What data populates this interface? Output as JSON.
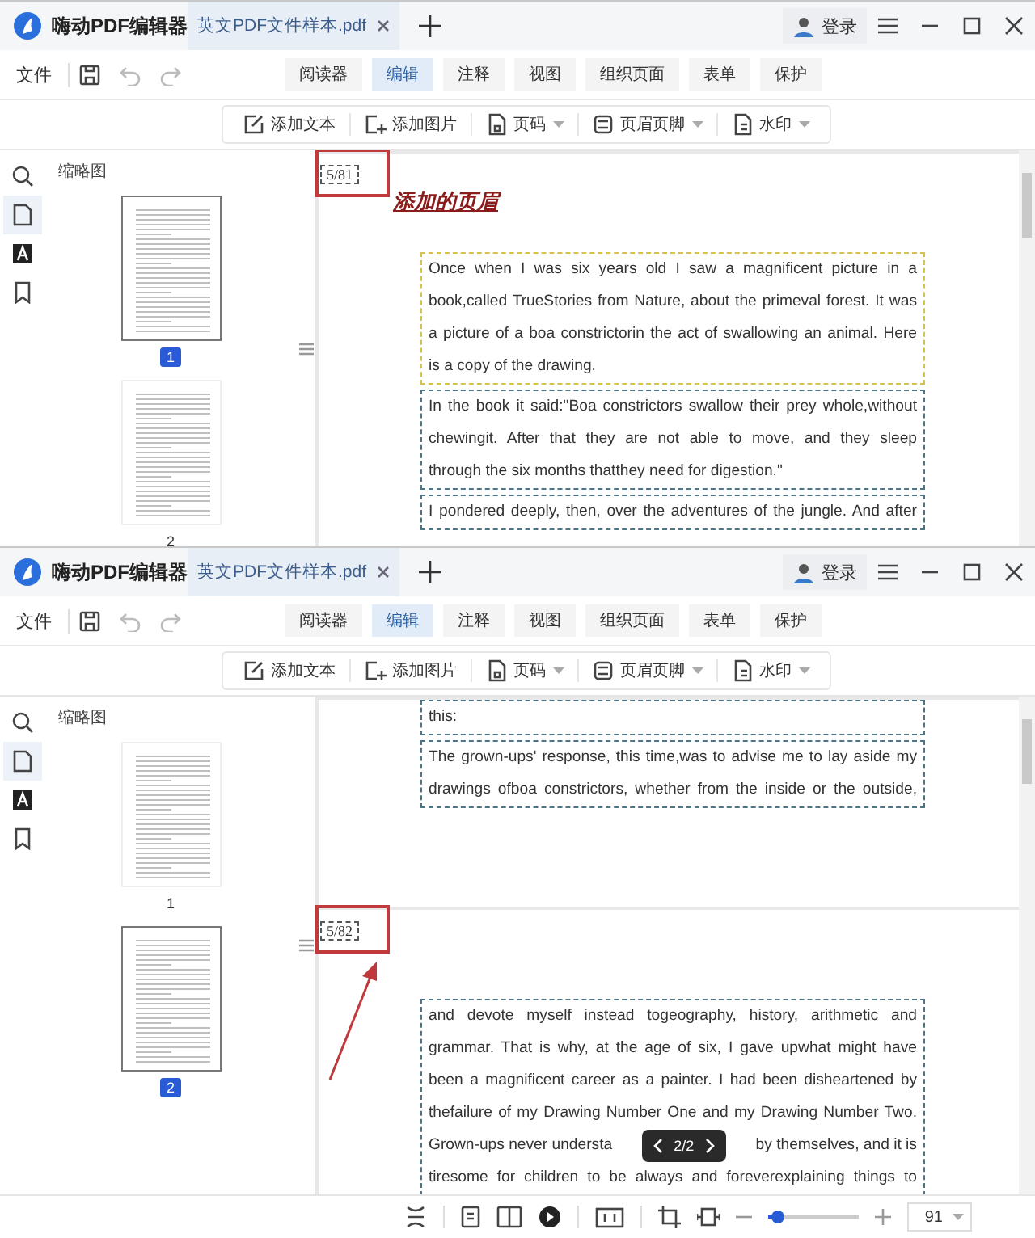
{
  "windows": [
    {
      "app_title": "嗨动PDF编辑器",
      "tab_title": "英文PDF文件样本.pdf",
      "login": "登录",
      "file_menu": "文件",
      "ribbon_tabs": [
        {
          "label": "阅读器",
          "selected": false
        },
        {
          "label": "编辑",
          "selected": true
        },
        {
          "label": "注释",
          "selected": false
        },
        {
          "label": "视图",
          "selected": false
        },
        {
          "label": "组织页面",
          "selected": false
        },
        {
          "label": "表单",
          "selected": false
        },
        {
          "label": "保护",
          "selected": false
        }
      ],
      "tools": [
        {
          "kind": "text",
          "label": "添加文本",
          "dropdown": false
        },
        {
          "kind": "image",
          "label": "添加图片",
          "dropdown": false
        },
        {
          "kind": "pagenum",
          "label": "页码",
          "dropdown": true
        },
        {
          "kind": "headerfooter",
          "label": "页眉页脚",
          "dropdown": true
        },
        {
          "kind": "watermark",
          "label": "水印",
          "dropdown": true
        }
      ],
      "sidebar": {
        "title": "缩略图",
        "rail": [
          {
            "kind": "search",
            "selected": false
          },
          {
            "kind": "page",
            "selected": true
          },
          {
            "kind": "font",
            "selected": false
          },
          {
            "kind": "bookmark",
            "selected": false
          }
        ],
        "thumbnails": [
          {
            "label": "1",
            "selected": true
          },
          {
            "label": "2",
            "selected": false
          }
        ]
      },
      "pages": [
        {
          "stamp": {
            "text": "5/81",
            "highlighted": true,
            "arrow": false
          },
          "header": "添加的页眉",
          "blocks": [
            {
              "color": "#d6c24c",
              "continues": false,
              "lines": [
                "Once when I was six years old I saw a magnificent picture in a",
                "book,called TrueStories from Nature, about the primeval forest. It was",
                "a picture of a boa constrictorin the act of swallowing an animal. Here",
                "is a copy of the drawing."
              ]
            },
            {
              "color": "#4d7585",
              "continues": false,
              "lines": [
                "In the book it said:\"Boa constrictors swallow their prey whole,without",
                "chewingit. After that they are not able to move, and they sleep",
                "through the six months thatthey need for digestion.\""
              ]
            },
            {
              "color": "#4d7585",
              "continues": true,
              "lines": [
                "I pondered deeply, then, over the adventures of the jungle. And after"
              ]
            }
          ]
        }
      ]
    },
    {
      "app_title": "嗨动PDF编辑器",
      "tab_title": "英文PDF文件样本.pdf",
      "login": "登录",
      "file_menu": "文件",
      "ribbon_tabs": [
        {
          "label": "阅读器",
          "selected": false
        },
        {
          "label": "编辑",
          "selected": true
        },
        {
          "label": "注释",
          "selected": false
        },
        {
          "label": "视图",
          "selected": false
        },
        {
          "label": "组织页面",
          "selected": false
        },
        {
          "label": "表单",
          "selected": false
        },
        {
          "label": "保护",
          "selected": false
        }
      ],
      "tools": [
        {
          "kind": "text",
          "label": "添加文本",
          "dropdown": false
        },
        {
          "kind": "image",
          "label": "添加图片",
          "dropdown": false
        },
        {
          "kind": "pagenum",
          "label": "页码",
          "dropdown": true
        },
        {
          "kind": "headerfooter",
          "label": "页眉页脚",
          "dropdown": true
        },
        {
          "kind": "watermark",
          "label": "水印",
          "dropdown": true
        }
      ],
      "sidebar": {
        "title": "缩略图",
        "rail": [
          {
            "kind": "search",
            "selected": false
          },
          {
            "kind": "page",
            "selected": true
          },
          {
            "kind": "font",
            "selected": false
          },
          {
            "kind": "bookmark",
            "selected": false
          }
        ],
        "thumbnails": [
          {
            "label": "1",
            "selected": false
          },
          {
            "label": "2",
            "selected": true
          }
        ]
      },
      "pages": [
        {
          "blocks": [
            {
              "color": "#4d7585",
              "lines": [
                "this:"
              ]
            },
            {
              "color": "#4d7585",
              "continues": true,
              "lines": [
                "The grown-ups' response, this time,was to advise me to lay aside my",
                "drawings ofboa constrictors,  whether from the inside or the outside,"
              ]
            }
          ]
        },
        {
          "stamp": {
            "text": "5/82",
            "highlighted": true,
            "arrow": true
          },
          "blocks": [
            {
              "color": "#4d7585",
              "continues": true,
              "lines": [
                "and devote myself instead togeography,   history, arithmetic and",
                "grammar. That is why,   at the age of six,   I gave upwhat might have",
                "been a magnificent career as a painter. I had been disheartened by",
                "thefailure of my Drawing Number One and my Drawing Number Two.",
                {
                  "kind": "split",
                  "left": "Grown-ups never understa",
                  "right": "by themselves, and it is"
                },
                "tiresome for children to be always and foreverexplaining things to"
              ]
            }
          ]
        }
      ],
      "page_nav": "2/2",
      "status_bar": {
        "zoom_slider": {
          "level": 0.1
        },
        "zoom_value": "91"
      }
    }
  ]
}
